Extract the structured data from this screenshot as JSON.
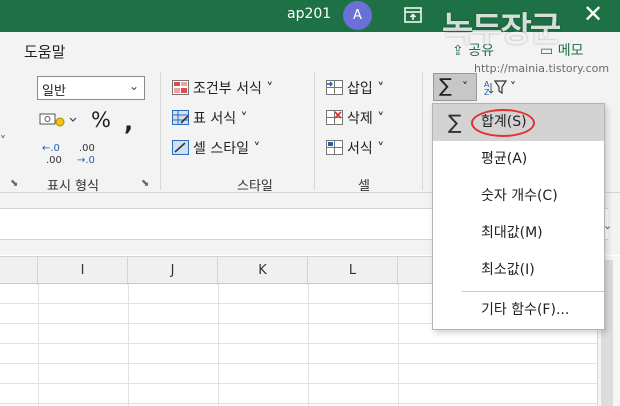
{
  "window": {
    "title": "ap201",
    "avatar_initial": "A"
  },
  "ribbon": {
    "tab_help": "도움말",
    "share": "공유",
    "memo": "메모",
    "number": {
      "format_value": "일반",
      "percent": "%",
      "comma": ",",
      "inc_decimal": "←.0\n.00",
      "dec_decimal": ".00\n→.0",
      "group_label": "표시 형식"
    },
    "styles": {
      "conditional_formatting": "조건부 서식 ˅",
      "format_as_table": "표 서식 ˅",
      "cell_styles": "셀 스타일 ˅",
      "group_label": "스타일"
    },
    "cells": {
      "insert": "삽입 ˅",
      "delete": "삭제 ˅",
      "format": "서식 ˅",
      "group_label": "셀"
    },
    "editing": {
      "autosum_glyph": "∑",
      "chevron": "˅"
    }
  },
  "sheet": {
    "columns": [
      "I",
      "J",
      "K",
      "L"
    ]
  },
  "autosum_menu": {
    "items": [
      {
        "label": "합계(S)",
        "icon": "sigma-icon"
      },
      {
        "label": "평균(A)"
      },
      {
        "label": "숫자 개수(C)"
      },
      {
        "label": "최대값(M)"
      },
      {
        "label": "최소값(I)"
      },
      {
        "label": "기타 함수(F)..."
      }
    ]
  },
  "watermark": {
    "text": "녹두장군",
    "url": "http://mainia.tistory.com"
  },
  "colors": {
    "excel_green": "#1e7145",
    "highlight": "#d3d3d3",
    "annotation_red": "#e03030"
  }
}
